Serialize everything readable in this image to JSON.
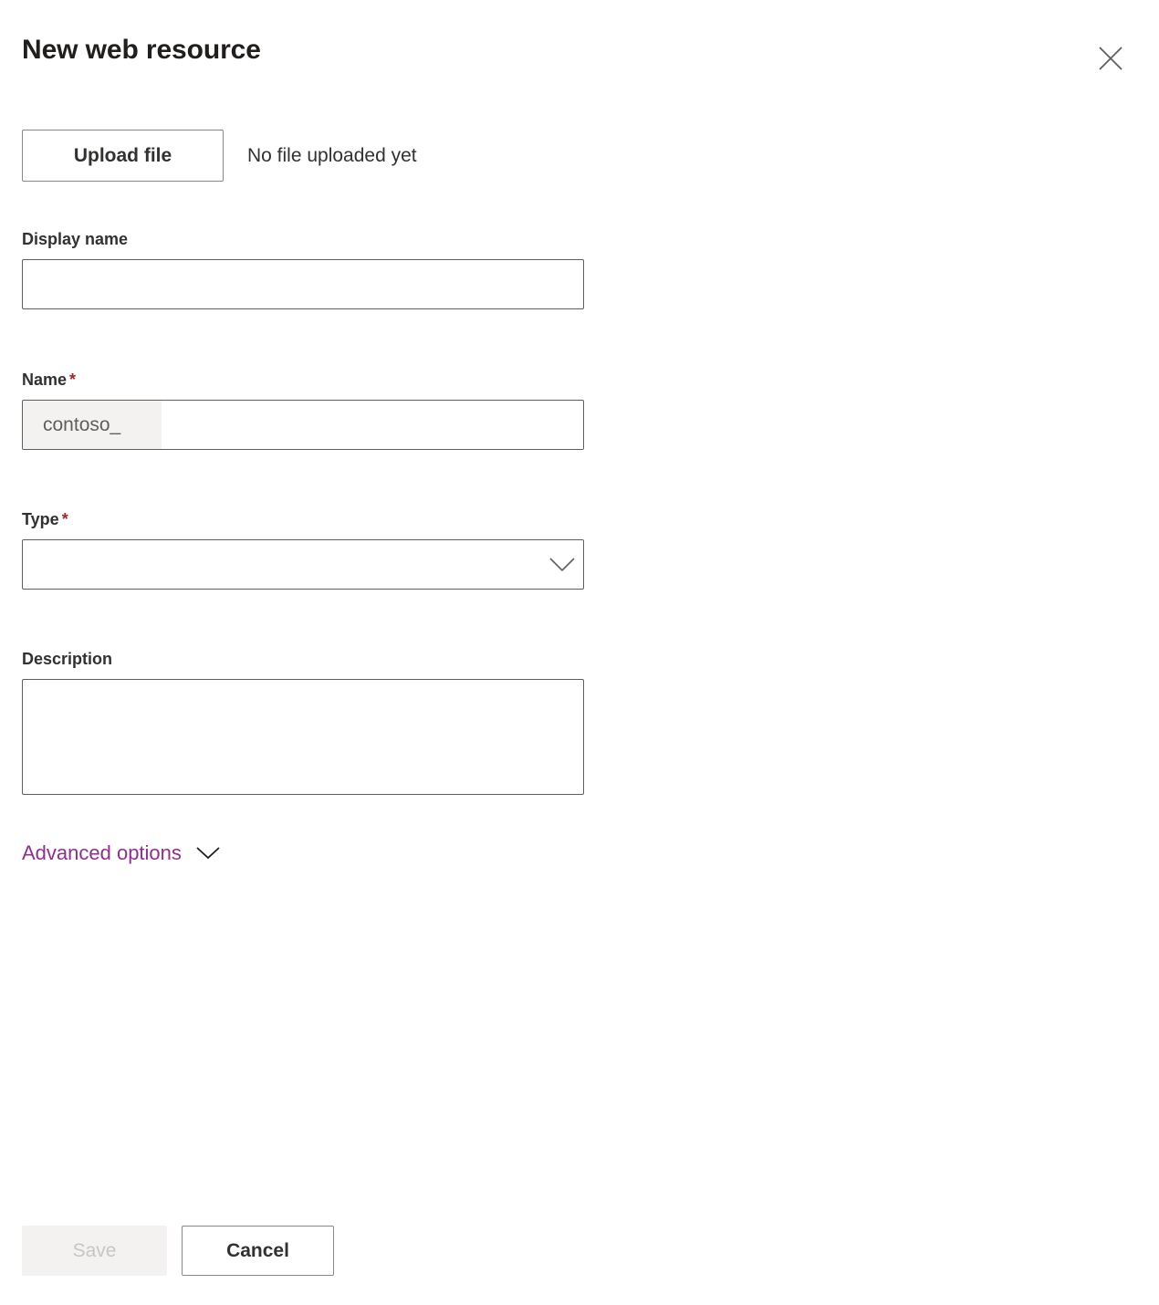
{
  "panel": {
    "title": "New web resource",
    "close_icon": "close-icon"
  },
  "upload": {
    "button_label": "Upload file",
    "status_text": "No file uploaded yet"
  },
  "fields": {
    "display_name": {
      "label": "Display name",
      "value": "",
      "placeholder": ""
    },
    "name": {
      "label": "Name",
      "required_marker": "*",
      "prefix": "contoso_",
      "value": "",
      "placeholder": ""
    },
    "type": {
      "label": "Type",
      "required_marker": "*",
      "selected_value": "",
      "chevron_icon": "chevron-down-icon",
      "options": []
    },
    "description": {
      "label": "Description",
      "value": "",
      "placeholder": ""
    }
  },
  "advanced_options": {
    "label": "Advanced options",
    "chevron_icon": "chevron-down-icon",
    "expanded": false
  },
  "footer": {
    "save_label": "Save",
    "save_disabled": true,
    "cancel_label": "Cancel"
  },
  "colors": {
    "accent": "#8f2f8f",
    "required": "#a4262c",
    "text": "#323130",
    "title": "#201f1e",
    "border": "#605e5c",
    "button_border": "#8a8886",
    "disabled_bg": "#f3f2f1",
    "disabled_text": "#c8c6c4",
    "prefix_bg": "#f3f2f1",
    "prefix_text": "#605e5c"
  }
}
